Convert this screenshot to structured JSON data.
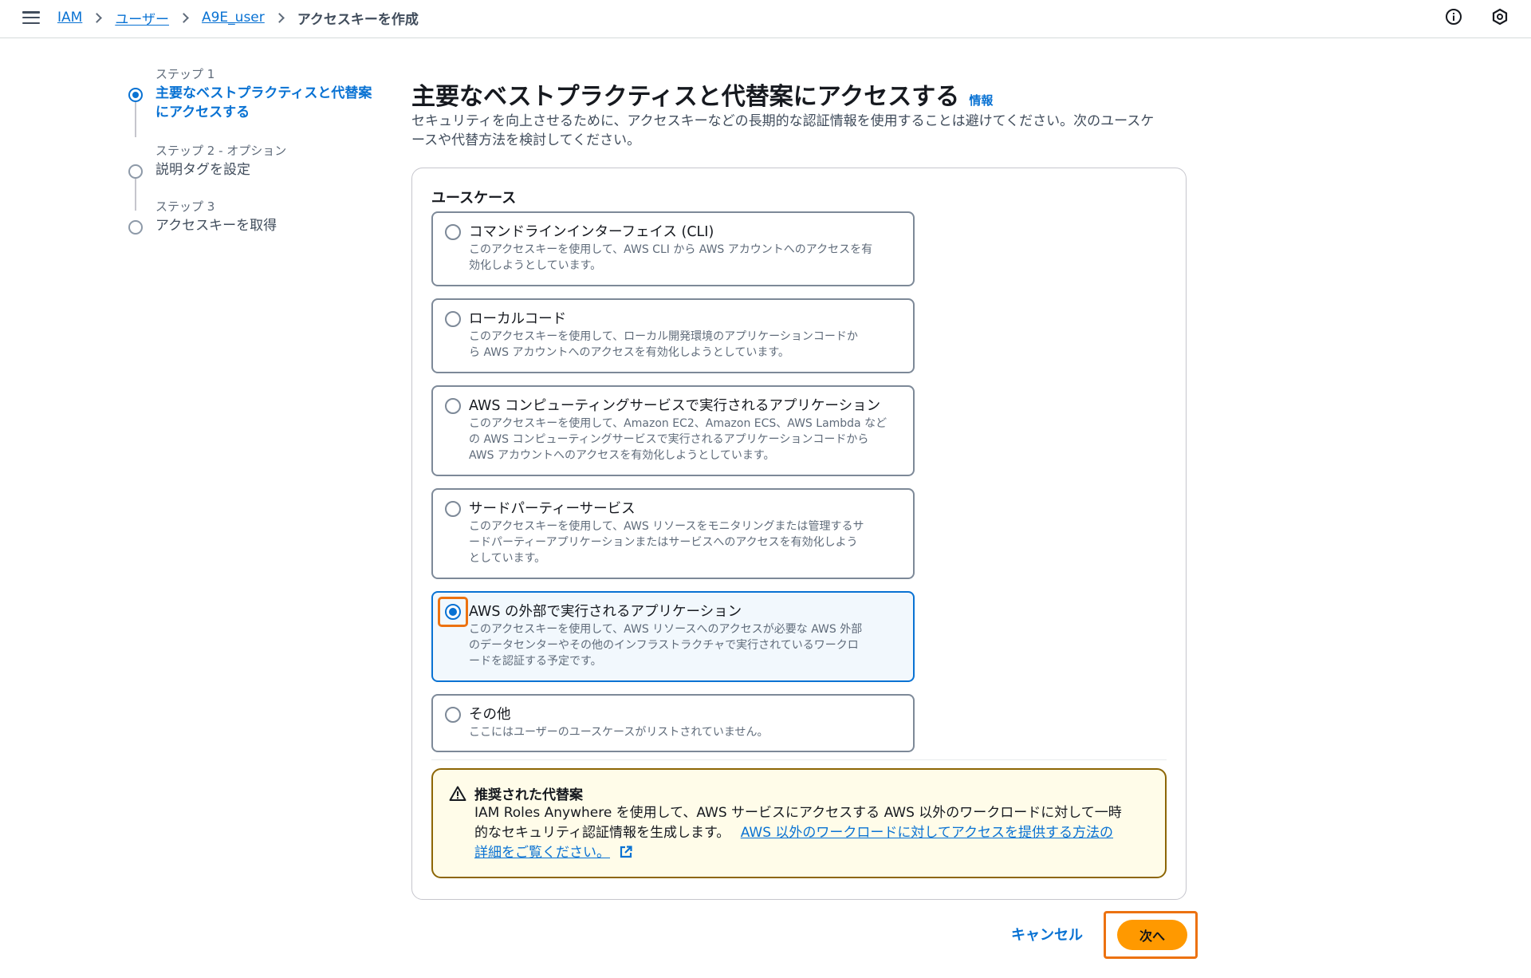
{
  "breadcrumb": {
    "items": [
      "IAM",
      "ユーザー",
      "A9E_user"
    ],
    "current": "アクセスキーを作成"
  },
  "steps": [
    {
      "title": "ステップ 1",
      "label_line1": "主要なベストプラクティスと代替案",
      "label_line2": "にアクセスする",
      "state": "active"
    },
    {
      "title": "ステップ 2 - オプション",
      "label_line1": "説明タグを設定",
      "state": "inactive"
    },
    {
      "title": "ステップ 3",
      "label_line1": "アクセスキーを取得",
      "state": "inactive"
    }
  ],
  "page": {
    "title": "主要なベストプラクティスと代替案にアクセスする",
    "info_link": "情報",
    "desc_line1": "セキュリティを向上させるために、アクセスキーなどの長期的な認証情報を使用することは避けてください。次のユースケ",
    "desc_line2": "ースや代替方法を検討してください。"
  },
  "use_case": {
    "label": "ユースケース",
    "selected": "AWS の外部で実行されるアプリケーション",
    "options": [
      {
        "title": "コマンドラインインターフェイス (CLI)",
        "desc": [
          "このアクセスキーを使用して、AWS CLI から AWS アカウントへのアクセスを有",
          "効化しようとしています。"
        ]
      },
      {
        "title": "ローカルコード",
        "desc": [
          "このアクセスキーを使用して、ローカル開発環境のアプリケーションコードか",
          "ら AWS アカウントへのアクセスを有効化しようとしています。"
        ]
      },
      {
        "title": "AWS コンピューティングサービスで実行されるアプリケーション",
        "desc": [
          "このアクセスキーを使用して、Amazon EC2、Amazon ECS、AWS Lambda など",
          "の AWS コンピューティングサービスで実行されるアプリケーションコードから",
          "AWS アカウントへのアクセスを有効化しようとしています。"
        ]
      },
      {
        "title": "サードパーティーサービス",
        "desc": [
          "このアクセスキーを使用して、AWS リソースをモニタリングまたは管理するサ",
          "ードパーティーアプリケーションまたはサービスへのアクセスを有効化しよう",
          "としています。"
        ]
      },
      {
        "title": "AWS の外部で実行されるアプリケーション",
        "desc": [
          "このアクセスキーを使用して、AWS リソースへのアクセスが必要な AWS 外部",
          "のデータセンターやその他のインフラストラクチャで実行されているワークロ",
          "ードを認証する予定です。"
        ]
      },
      {
        "title": "その他",
        "desc": [
          "ここにはユーザーのユースケースがリストされていません。"
        ]
      }
    ]
  },
  "alert": {
    "title": "推奨された代替案",
    "line1": "IAM Roles Anywhere を使用して、AWS サービスにアクセスする AWS 以外のワークロードに対して一時",
    "line2_text": "的なセキュリティ認証情報を生成します。",
    "link_part1": "AWS 以外のワークロードに対してアクセスを提供する方法の",
    "link_part2": "詳細をご覧ください。"
  },
  "footer": {
    "cancel_label": "キャンセル",
    "next_label": "次へ"
  },
  "colors": {
    "link": "#0972d3",
    "primary_button": "#ff9900",
    "highlight": "#ec7211",
    "alert_border": "#8d6605",
    "alert_bg": "#fffce9"
  }
}
